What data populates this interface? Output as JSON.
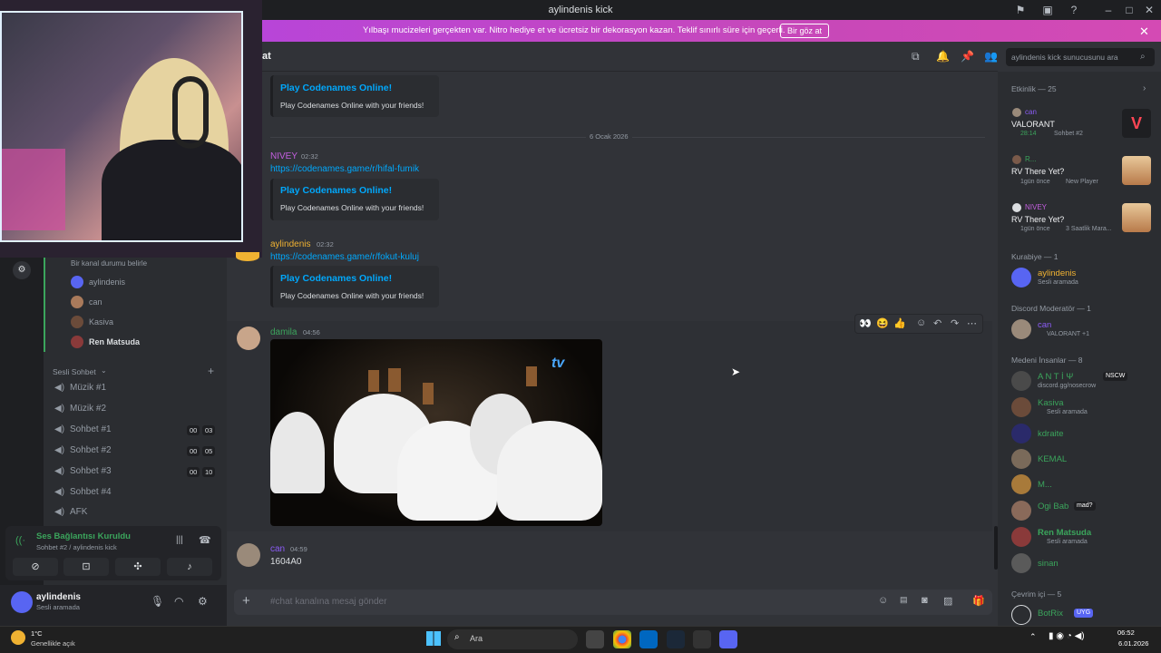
{
  "window": {
    "title": "aylindenis kick"
  },
  "banner": {
    "text": "Yılbaşı mucizeleri gerçekten var. Nitro hediye et ve ücretsiz bir dekorasyon kazan. Teklif sınırlı süre için geçerli.",
    "button": "Bir göz at"
  },
  "channel": {
    "title": "at",
    "search_placeholder": "aylindenis kick sunucusunu ara"
  },
  "messages": {
    "embed_title": "Play Codenames Online!",
    "embed_desc": "Play Codenames Online with your friends!",
    "date_divider": "6 Ocak 2026",
    "m1": {
      "user": "NIVEY",
      "time": "02:32",
      "link": "https://codenames.game/r/hifal-fumik"
    },
    "m2": {
      "user": "aylindenis",
      "time": "02:32",
      "link": "https://codenames.game/r/fokut-kuluj"
    },
    "m3": {
      "user": "damila",
      "time": "04:56"
    },
    "m4": {
      "user": "can",
      "time": "04:59",
      "text": "1604A0"
    }
  },
  "composer": {
    "placeholder": "#chat kanalına mesaj gönder"
  },
  "sidebar": {
    "status_hint": "Bir kanal durumu belirle",
    "voice_users": [
      "aylindenis",
      "can",
      "Kasiva",
      "Ren Matsuda"
    ],
    "category": "Sesli Sohbet",
    "channels": [
      {
        "name": "Müzik #1",
        "count": ""
      },
      {
        "name": "Müzik #2",
        "count": ""
      },
      {
        "name": "Sohbet #1",
        "count_a": "00",
        "count_b": "03"
      },
      {
        "name": "Sohbet #2",
        "count_a": "00",
        "count_b": "05"
      },
      {
        "name": "Sohbet #3",
        "count_a": "00",
        "count_b": "10"
      },
      {
        "name": "Sohbet #4",
        "count": ""
      },
      {
        "name": "AFK",
        "count": ""
      }
    ],
    "voice_status": "Ses Bağlantısı Kuruldu",
    "voice_location": "Sohbet #2 / aylindenis kick",
    "user": {
      "name": "aylindenis",
      "status": "Sesli aramada"
    }
  },
  "members": {
    "activity_header": "Etkinlik — 25",
    "activities": [
      {
        "user": "can",
        "title": "VALORANT",
        "sub": "28:14",
        "sub2": "Sohbet #2"
      },
      {
        "user": "R...",
        "title": "RV There Yet?",
        "sub": "1gün önce",
        "sub2": "New Player"
      },
      {
        "user": "NIVEY",
        "title": "RV There Yet?",
        "sub": "1gün önce",
        "sub2": "3 Saatlik Mara..."
      }
    ],
    "groups": [
      {
        "header": "Kurabiye — 1",
        "items": [
          {
            "name": "aylindenis",
            "sub": "Sesli aramada",
            "color": "#f0b232"
          }
        ]
      },
      {
        "header": "Discord Moderatör — 1",
        "items": [
          {
            "name": "can",
            "sub": "VALORANT +1",
            "color": "#8b5cf6"
          }
        ]
      },
      {
        "header": "Medeni İnsanlar — 8",
        "items": [
          {
            "name": "A N T İ Ψ",
            "sub": "discord.gg/nosecrow",
            "color": "#3ba55c",
            "badge": "NSCW"
          },
          {
            "name": "Kasiva",
            "sub": "Sesli aramada",
            "color": "#3ba55c"
          },
          {
            "name": "kdraite",
            "sub": "",
            "color": "#3ba55c"
          },
          {
            "name": "KEMAL",
            "sub": "",
            "color": "#3ba55c"
          },
          {
            "name": "M...",
            "sub": "",
            "color": "#3ba55c"
          },
          {
            "name": "Ogi Bab",
            "sub": "",
            "color": "#3ba55c",
            "badge": "mad?"
          },
          {
            "name": "Ren Matsuda",
            "sub": "Sesli aramada",
            "color": "#3ba55c"
          },
          {
            "name": "sinan",
            "sub": "",
            "color": "#3ba55c"
          }
        ]
      },
      {
        "header": "Çevrim içi — 5",
        "items": [
          {
            "name": "BotRix",
            "sub": "",
            "color": "#3ba55c",
            "badge": "UYG"
          }
        ]
      }
    ]
  },
  "taskbar": {
    "weather_temp": "1°C",
    "weather_desc": "Genellikle açık",
    "search": "Ara",
    "time": "06:52",
    "date": "6.01.2026"
  }
}
